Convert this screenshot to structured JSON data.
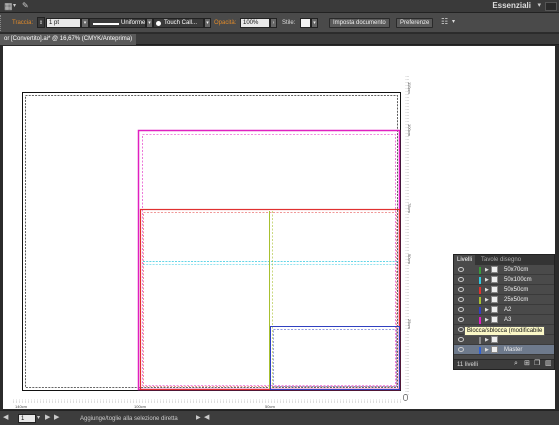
{
  "app": {
    "workspace": "Essenziali",
    "topbar_icons": [
      "layout-icon",
      "bridge-icon"
    ]
  },
  "control": {
    "stroke_label": "Traccia:",
    "stroke_weight": "1 pt",
    "stroke_profile": "Uniforme",
    "brush": "Touch Call...",
    "opacity_label": "Opacità:",
    "opacity_value": "100%",
    "style_label": "Stile:",
    "doc_setup_button": "Imposta documento",
    "prefs_button": "Preferenze"
  },
  "document": {
    "tab_title": "or [Convertito].ai* @ 16,67% (CMYK/Anteprima)"
  },
  "rulers": {
    "right": [
      "110cm",
      "100cm",
      "75cm",
      "50cm",
      "25cm"
    ],
    "bottom": [
      "140cm",
      "100cm",
      "50cm"
    ]
  },
  "colors": {
    "accent": "#e08a2a",
    "magenta": "#e020c0",
    "red": "#e03030",
    "cyan": "#30c8e0",
    "olive": "#a8c030",
    "navy": "#3040c0",
    "tooltip": "#fbf8c7",
    "selected_row": "#6e7a8c"
  },
  "layers_panel": {
    "tabs": [
      "Livelli",
      "Tavole disegno"
    ],
    "layers": [
      {
        "name": "50x70cm",
        "color": "#3a9a3a",
        "selected": false
      },
      {
        "name": "50x100cm",
        "color": "#30c8e0",
        "selected": false
      },
      {
        "name": "50x50cm",
        "color": "#e03030",
        "selected": false
      },
      {
        "name": "25x50cm",
        "color": "#a8c030",
        "selected": false
      },
      {
        "name": "A2",
        "color": "#3040c0",
        "selected": false
      },
      {
        "name": "A3",
        "color": "#e020c0",
        "selected": false
      },
      {
        "name": "A4",
        "color": "#e08a2a",
        "selected": false
      },
      {
        "name": "",
        "color": "#8a8a8a",
        "selected": false
      },
      {
        "name": "Master",
        "color": "#3060d0",
        "selected": true
      }
    ],
    "count": "11 livelli",
    "tooltip": "Blocca/sblocca (modificabile"
  },
  "status": {
    "zoom": "1",
    "message": "Aggiunge/toglie alla selezione diretta"
  }
}
